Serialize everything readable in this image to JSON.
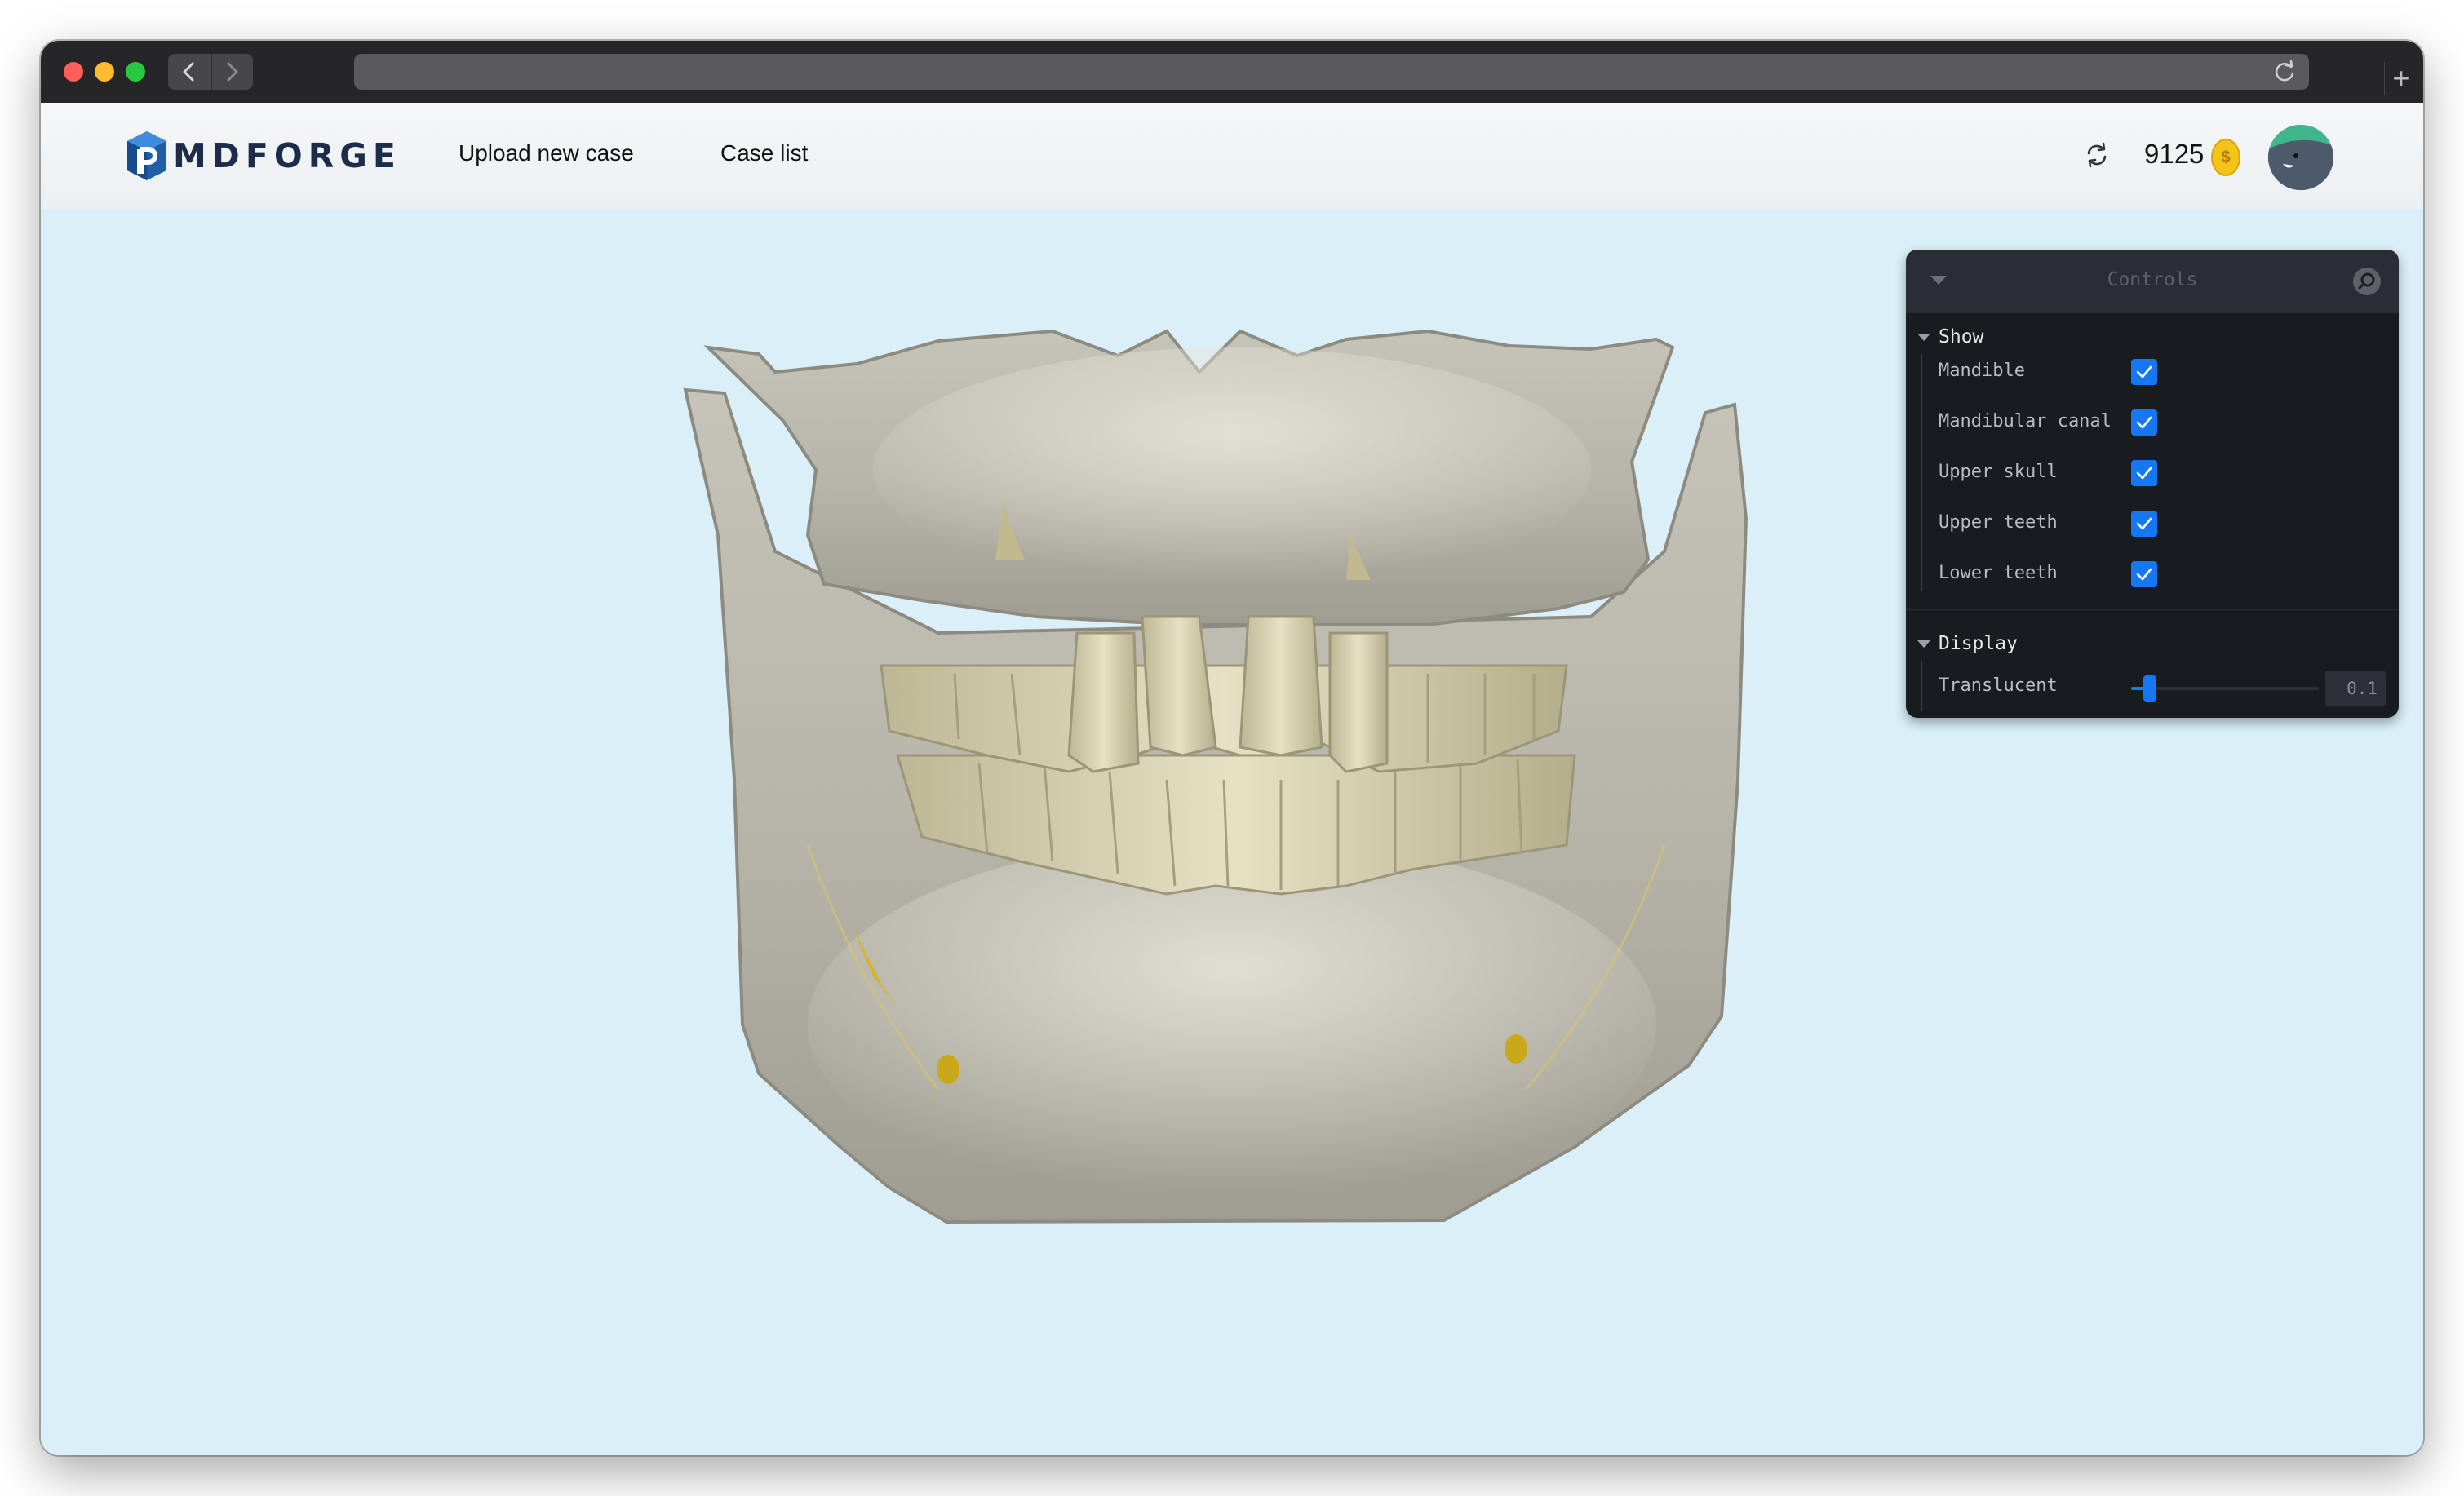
{
  "browser": {
    "back_icon": "chevron-left-icon",
    "forward_icon": "chevron-right-icon",
    "reload_icon": "reload-icon",
    "new_tab_label": "+"
  },
  "header": {
    "logo_text": "MDFORGE",
    "nav": {
      "upload_label": "Upload new case",
      "cases_label": "Case list"
    },
    "credits": "9125",
    "coin_symbol": "$"
  },
  "controls": {
    "title": "Controls",
    "show": {
      "label": "Show",
      "items": [
        {
          "label": "Mandible",
          "checked": true
        },
        {
          "label": "Mandibular canal",
          "checked": true
        },
        {
          "label": "Upper skull",
          "checked": true
        },
        {
          "label": "Upper teeth",
          "checked": true
        },
        {
          "label": "Lower teeth",
          "checked": true
        }
      ]
    },
    "display": {
      "label": "Display",
      "translucent_label": "Translucent",
      "translucent_value": "0.1",
      "translucent_fraction": 0.1
    }
  },
  "colors": {
    "accent": "#1677f5",
    "viewport_bg": "#daeff8",
    "panel_bg": "#181b1f",
    "bone": "#c9c7bb",
    "teeth": "#d9d4b4",
    "canal": "#d8b41c"
  }
}
